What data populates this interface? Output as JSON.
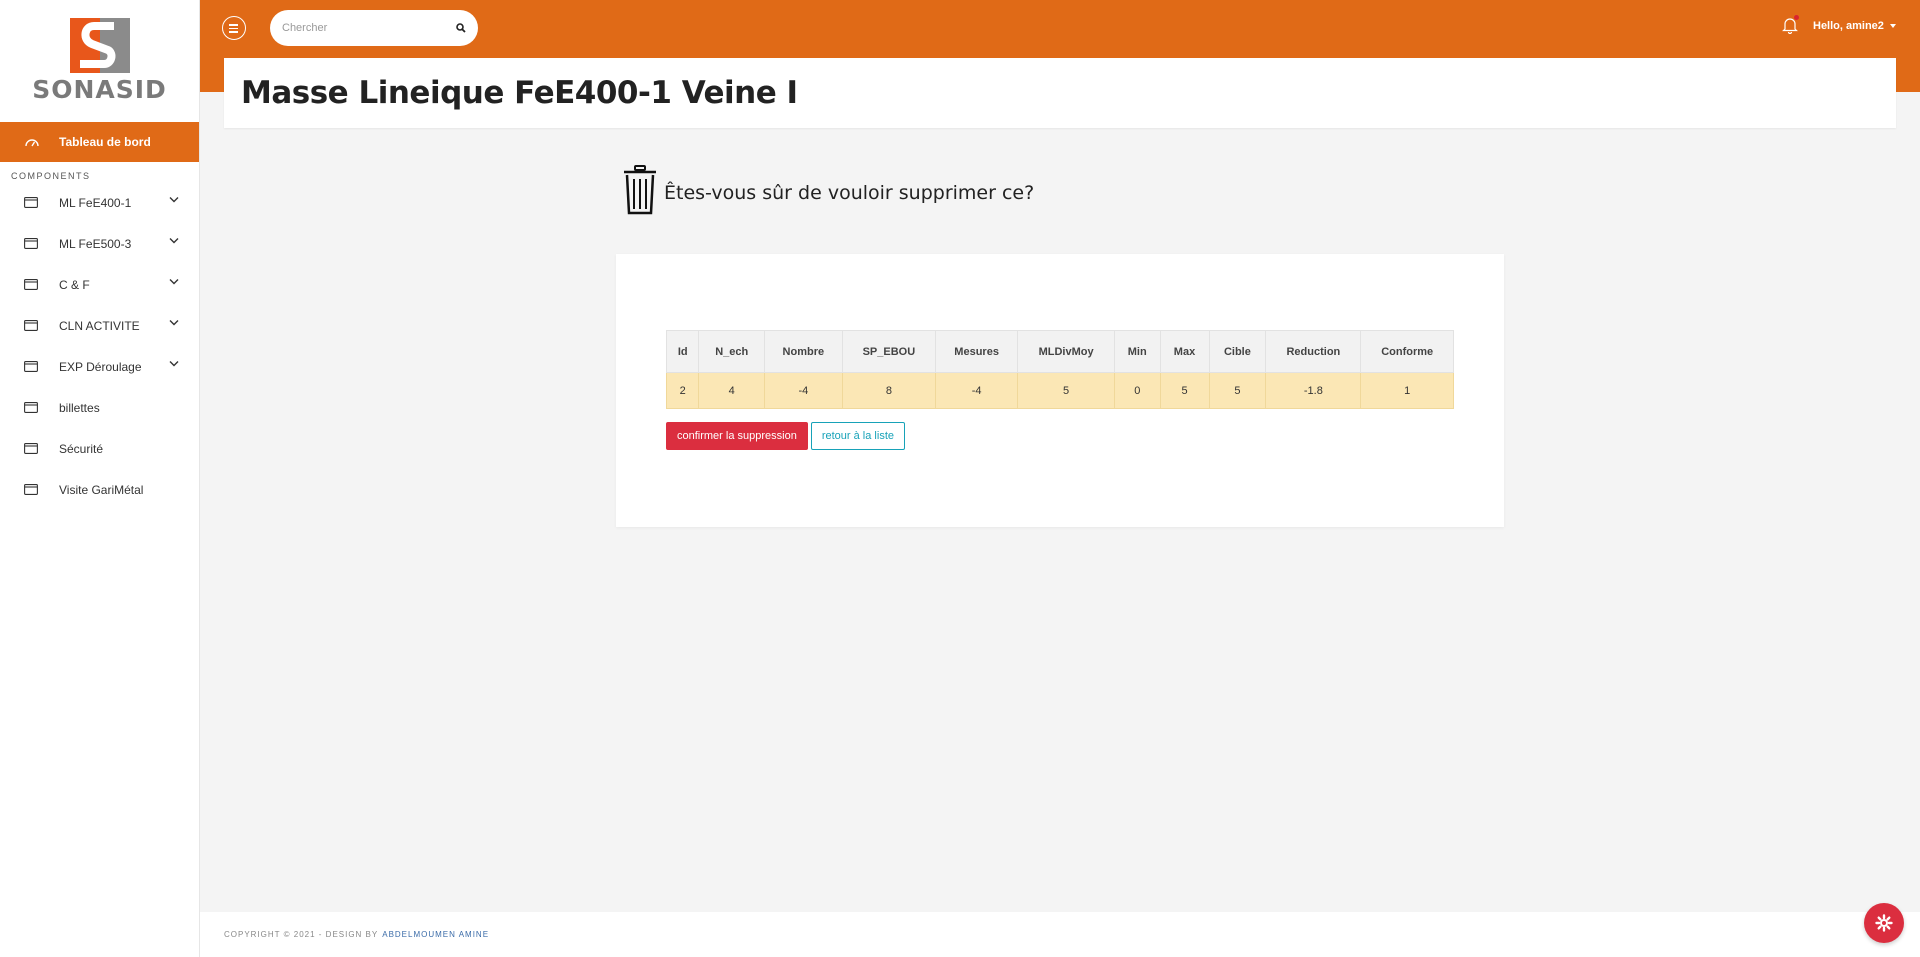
{
  "brand": {
    "name": "SONASID",
    "accent": "#e06a17"
  },
  "sidebar": {
    "active": {
      "label": "Tableau de bord",
      "icon": "dashboard-icon"
    },
    "section": "COMPONENTS",
    "items": [
      {
        "label": "ML FeE400-1",
        "icon": "window-icon",
        "expandable": true
      },
      {
        "label": "ML FeE500-3",
        "icon": "window-icon",
        "expandable": true
      },
      {
        "label": "C & F",
        "icon": "window-icon",
        "expandable": true
      },
      {
        "label": "CLN ACTIVITE",
        "icon": "window-icon",
        "expandable": true
      },
      {
        "label": "EXP Déroulage",
        "icon": "window-icon",
        "expandable": true
      },
      {
        "label": "billettes",
        "icon": "window-icon",
        "expandable": false
      },
      {
        "label": "Sécurité",
        "icon": "window-icon",
        "expandable": false
      },
      {
        "label": "Visite GariMétal",
        "icon": "window-icon",
        "expandable": false
      }
    ]
  },
  "topbar": {
    "search_placeholder": "Chercher",
    "user_greeting": "Hello, amine2"
  },
  "page": {
    "title": "Masse Lineique FeE400-1 Veine I",
    "question": "Êtes-vous sûr de vouloir supprimer ce?"
  },
  "table": {
    "headers": [
      "Id",
      "N_ech",
      "Nombre",
      "SP_EBOU",
      "Mesures",
      "MLDivMoy",
      "Min",
      "Max",
      "Cible",
      "Reduction",
      "Conforme"
    ],
    "row": [
      "2",
      "4",
      "-4",
      "8",
      "-4",
      "5",
      "0",
      "5",
      "5",
      "-1.8",
      "1"
    ]
  },
  "actions": {
    "confirm_label": "confirmer la suppression",
    "back_label": "retour à la liste"
  },
  "footer": {
    "copyright": "COPYRIGHT © 2021  -  DESIGN BY",
    "author": "ABDELMOUMEN AMINE"
  },
  "colors": {
    "danger": "#db2e3f",
    "info": "#17a2b8",
    "row_highlight": "#fbe7b5"
  }
}
